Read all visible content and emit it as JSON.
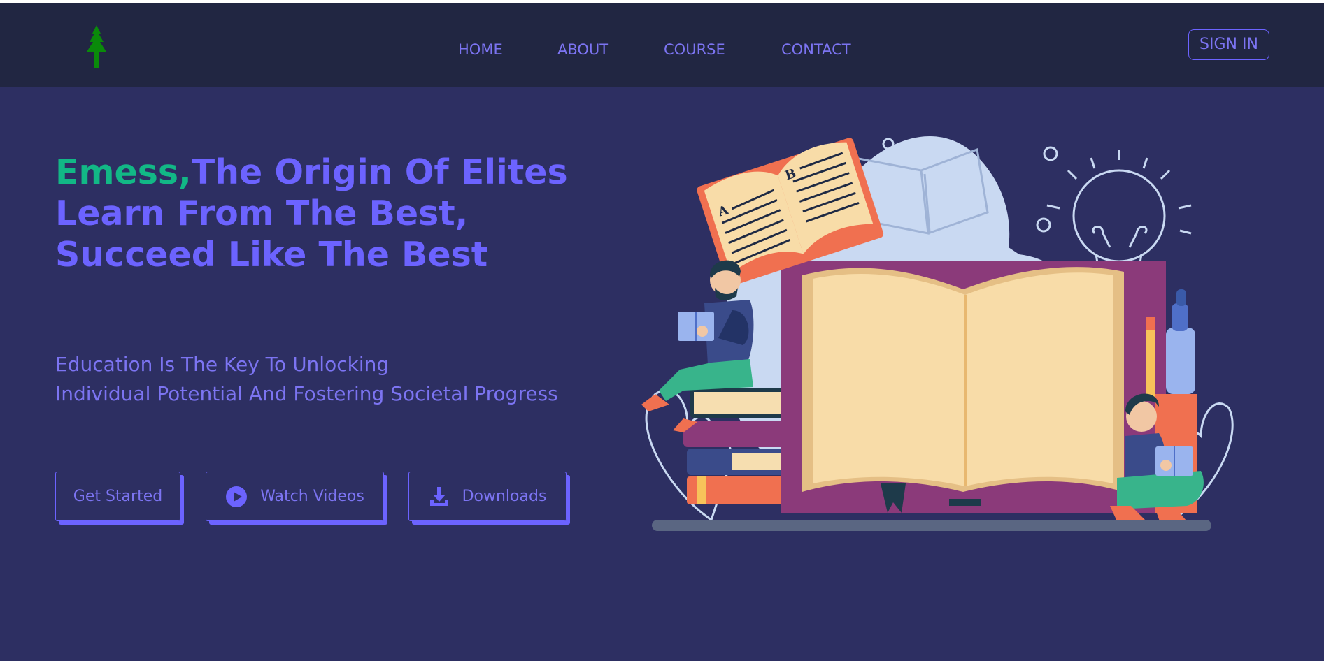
{
  "nav": {
    "logo_icon": "pine-tree-icon",
    "links": [
      "HOME",
      "ABOUT",
      "COURSE",
      "CONTACT"
    ],
    "sign_in": "SIGN IN"
  },
  "hero": {
    "title_brand": "Emess,",
    "title_rest": "The Origin Of Elites Learn From The Best, Succeed Like The Best",
    "subtitle_line1": "Education Is The Key To Unlocking",
    "subtitle_line2": "Individual Potential And Fostering Societal Progress",
    "buttons": {
      "get_started": "Get Started",
      "watch_videos": "Watch Videos",
      "downloads": "Downloads"
    },
    "button_icons": [
      "play-circle-icon",
      "download-icon"
    ]
  },
  "colors": {
    "page_bg": "#2d2f62",
    "navbar_bg": "#212642",
    "accent": "#6c63ff",
    "brand_green": "#12b886",
    "logo_green": "#0a8a0a"
  },
  "illustration": {
    "book_page_letters": [
      "A",
      "B"
    ]
  }
}
